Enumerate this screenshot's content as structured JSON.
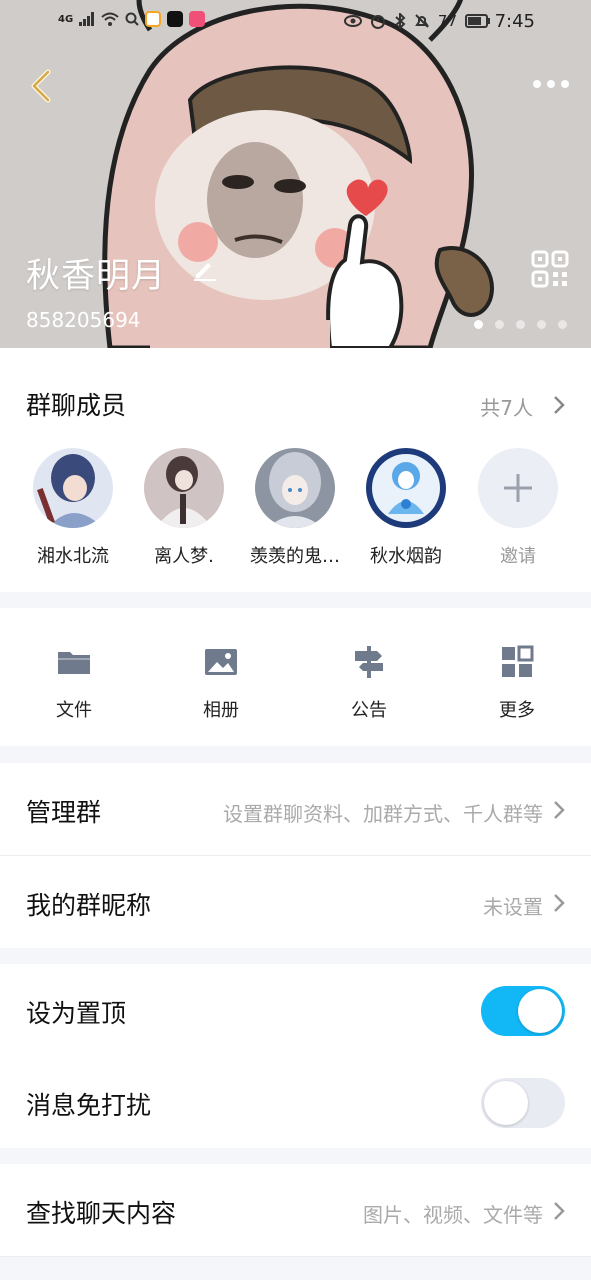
{
  "status_bar": {
    "network": "4G",
    "battery": "77",
    "time": "7:45"
  },
  "header": {
    "group_name": "秋香明月",
    "group_id": "858205694",
    "bg_color": "#d0ccca"
  },
  "members": {
    "title": "群聊成员",
    "count_label": "共7人",
    "list": [
      {
        "name": "湘水北流"
      },
      {
        "name": "离人梦."
      },
      {
        "name": "羡羡的鬼…"
      },
      {
        "name": "秋水烟韵"
      }
    ],
    "invite_label": "邀请"
  },
  "actions": [
    {
      "label": "文件",
      "icon": "folder-icon"
    },
    {
      "label": "相册",
      "icon": "image-icon"
    },
    {
      "label": "公告",
      "icon": "signpost-icon"
    },
    {
      "label": "更多",
      "icon": "grid-icon"
    }
  ],
  "settings": {
    "manage": {
      "label": "管理群",
      "value": "设置群聊资料、加群方式、千人群等"
    },
    "nickname": {
      "label": "我的群昵称",
      "value": "未设置"
    },
    "pin": {
      "label": "设为置顶",
      "on": true
    },
    "mute": {
      "label": "消息免打扰",
      "on": false
    },
    "search": {
      "label": "查找聊天内容",
      "value": "图片、视频、文件等"
    }
  },
  "colors": {
    "accent": "#12b7f5",
    "icon_gray": "#6f7a8c"
  }
}
